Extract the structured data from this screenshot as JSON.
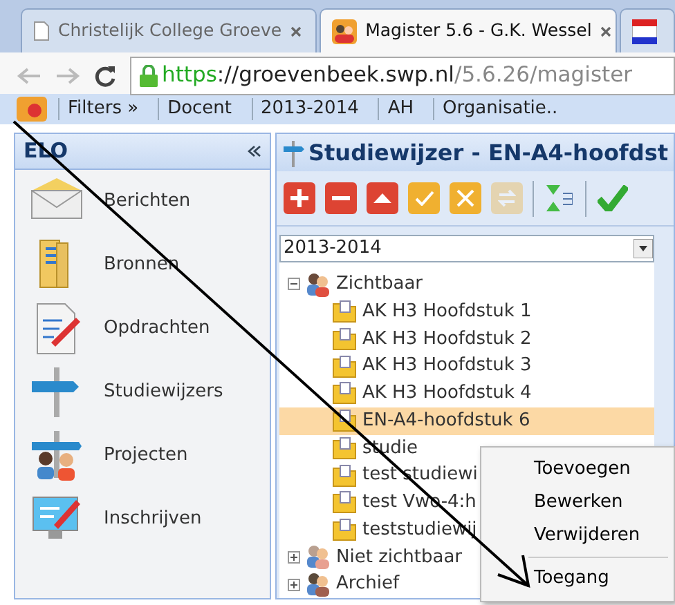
{
  "browser": {
    "tabs": [
      {
        "title": "Christelijk College Groeve",
        "selected": false,
        "kind": "page"
      },
      {
        "title": "Magister 5.6 - G.K. Wessel",
        "selected": true,
        "kind": "app"
      },
      {
        "selected": false,
        "kind": "fm"
      }
    ],
    "url": {
      "scheme": "https",
      "host": "://groevenbeek.swp.nl",
      "path": "/5.6.26/magister"
    }
  },
  "app_toolbar": [
    "Filters »",
    "Docent",
    "2013-2014",
    "AH",
    "Organisatie.."
  ],
  "sidebar": {
    "title": "ELO",
    "items": [
      {
        "label": "Berichten",
        "kind": "mail"
      },
      {
        "label": "Bronnen",
        "kind": "folder"
      },
      {
        "label": "Opdrachten",
        "kind": "doc"
      },
      {
        "label": "Studiewijzers",
        "kind": "sign"
      },
      {
        "label": "Projecten",
        "kind": "project"
      },
      {
        "label": "Inschrijven",
        "kind": "monitor"
      }
    ]
  },
  "panel": {
    "title": "Studiewijzer - EN-A4-hoofdst",
    "toolbar": [
      {
        "kind": "add",
        "disabled": false
      },
      {
        "kind": "remove",
        "disabled": false
      },
      {
        "kind": "up",
        "disabled": false
      },
      {
        "kind": "check",
        "disabled": false
      },
      {
        "kind": "cross",
        "disabled": false
      },
      {
        "kind": "sync",
        "disabled": true
      },
      {
        "kind": "sort",
        "disabled": false
      },
      {
        "kind": "ok",
        "disabled": false
      }
    ],
    "year": "2013-2014",
    "tree": [
      {
        "label": "Zichtbaar",
        "expanded": true,
        "kind": "group",
        "children": [
          {
            "label": "AK H3 Hoofdstuk 1",
            "selected": false
          },
          {
            "label": "AK H3 Hoofdstuk 2",
            "selected": false
          },
          {
            "label": "AK H3 Hoofdstuk 3",
            "selected": false
          },
          {
            "label": "AK H3 Hoofdstuk 4",
            "selected": false
          },
          {
            "label": "EN-A4-hoofdstuk 6",
            "selected": true
          },
          {
            "label": "studie",
            "selected": false
          },
          {
            "label": "test studiewi",
            "selected": false
          },
          {
            "label": "test Vwo-4:h",
            "selected": false
          },
          {
            "label": "teststudiewij",
            "selected": false
          }
        ]
      },
      {
        "label": "Niet zichtbaar",
        "expanded": false,
        "kind": "hidden"
      },
      {
        "label": "Archief",
        "expanded": false,
        "kind": "archive"
      }
    ]
  },
  "context_menu": [
    {
      "label": "Toevoegen",
      "separator_before": false
    },
    {
      "label": "Bewerken",
      "separator_before": false
    },
    {
      "label": "Verwijderen",
      "separator_before": false
    },
    {
      "label": "Toegang",
      "separator_before": true
    }
  ]
}
